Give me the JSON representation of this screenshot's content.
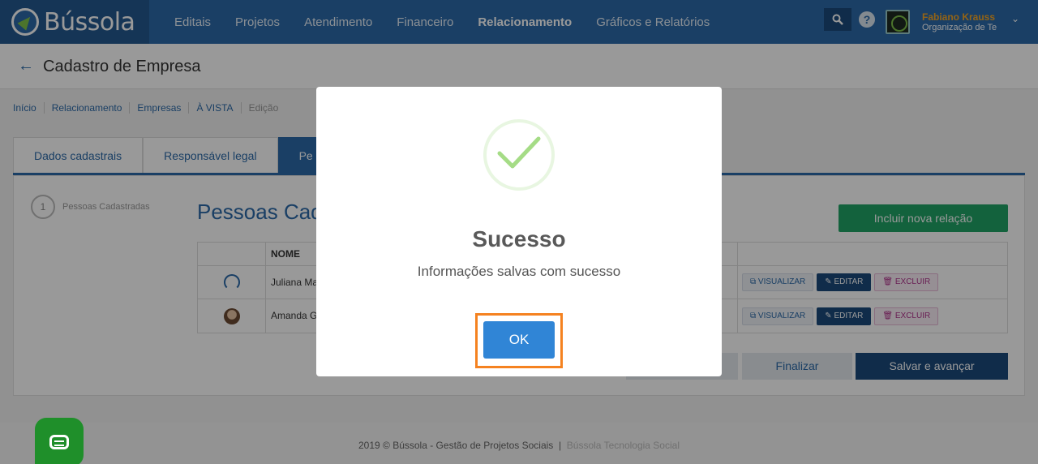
{
  "brand": {
    "name": "Bússola"
  },
  "nav": {
    "items": [
      "Editais",
      "Projetos",
      "Atendimento",
      "Financeiro",
      "Relacionamento",
      "Gráficos e Relatórios"
    ],
    "active": "Relacionamento"
  },
  "user": {
    "name": "Fabiano Krauss",
    "org": "Organização de Te"
  },
  "page": {
    "title": "Cadastro de Empresa"
  },
  "breadcrumb": [
    "Início",
    "Relacionamento",
    "Empresas",
    "À VISTA",
    "Edição"
  ],
  "tabs": [
    "Dados cadastrais",
    "Responsável legal",
    "Pe"
  ],
  "step": {
    "number": "1",
    "label": "Pessoas Cadastradas"
  },
  "section": {
    "title": "Pessoas Cad",
    "new_button": "Incluir nova relação"
  },
  "table": {
    "header_name": "NOME",
    "rows": [
      {
        "name": "Juliana Ma",
        "view": "VISUALIZAR",
        "edit": "EDITAR",
        "delete": "EXCLUIR"
      },
      {
        "name": "Amanda G",
        "view": "VISUALIZAR",
        "edit": "EDITAR",
        "delete": "EXCLUIR"
      }
    ]
  },
  "actions": {
    "finish": "Finalizar",
    "save_next": "Salvar e avançar"
  },
  "footer": {
    "text": "2019 © Bússola - Gestão de Projetos Sociais",
    "separator": "|",
    "link": "Bússola Tecnologia Social"
  },
  "modal": {
    "title": "Sucesso",
    "message": "Informações salvas com sucesso",
    "ok": "OK"
  },
  "colors": {
    "primary": "#2c6aa8",
    "success": "#21a366",
    "ok_button": "#3085d6",
    "highlight": "#f58220"
  }
}
